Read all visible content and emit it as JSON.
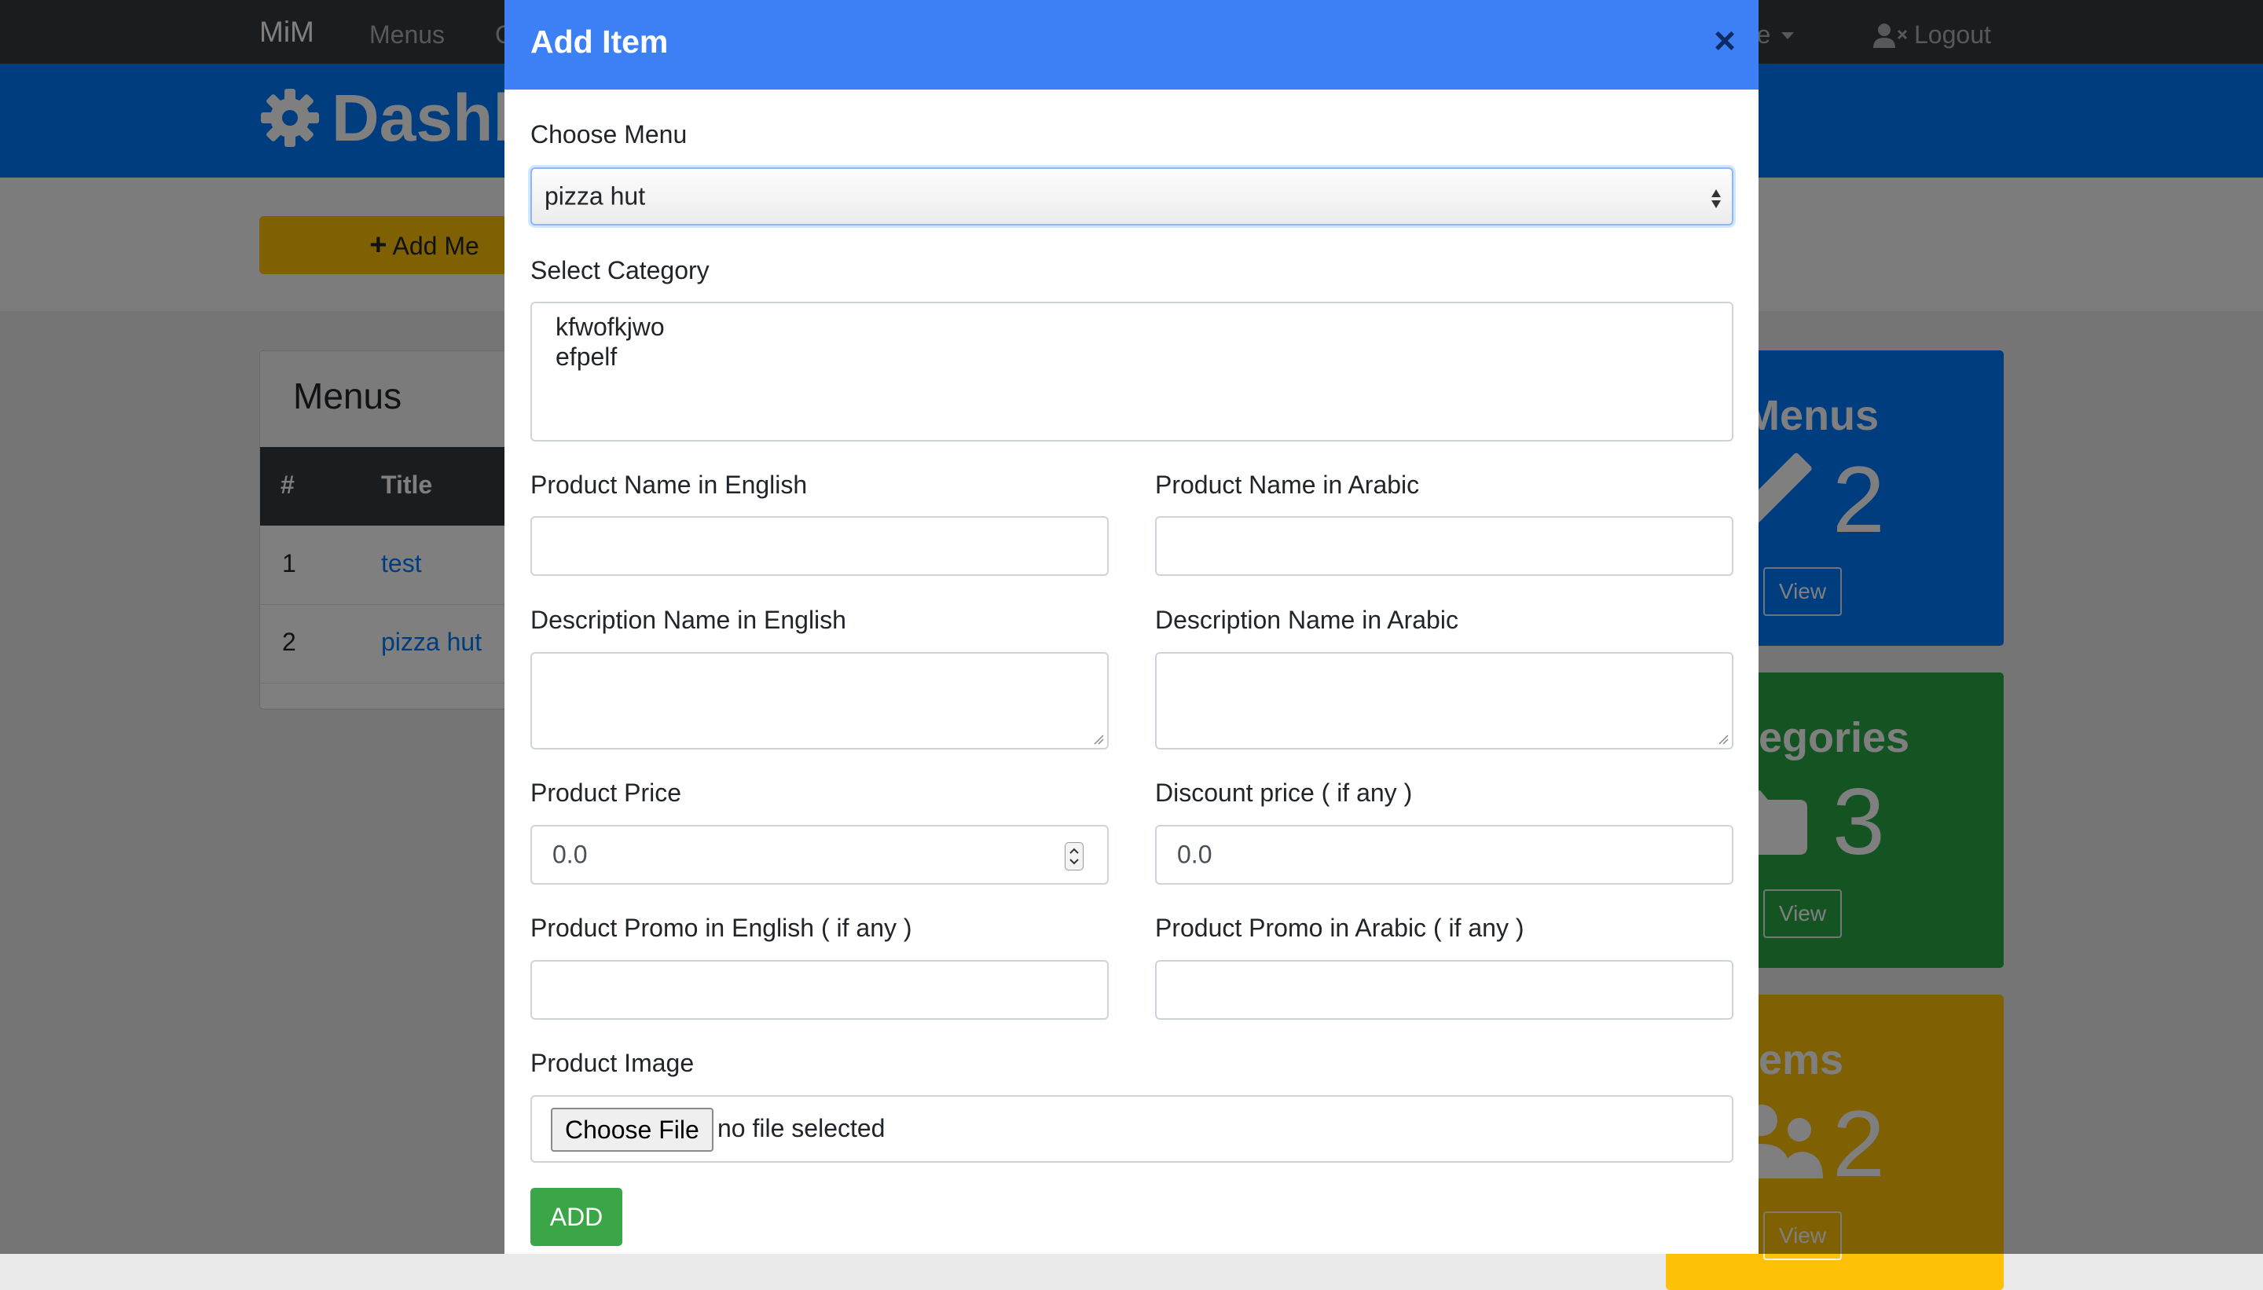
{
  "navbar": {
    "brand": "MiM",
    "menus_link": "Menus",
    "categories_link_partial": "C",
    "manage_link_partial": "age",
    "logout_label": "Logout"
  },
  "header": {
    "title_partial": "Dashb"
  },
  "actions": {
    "add_menu_label_partial": "Add Me"
  },
  "menus_card": {
    "title": "Menus",
    "columns": [
      "#",
      "Title"
    ],
    "rows": [
      {
        "num": "1",
        "title": "test"
      },
      {
        "num": "2",
        "title": "pizza hut"
      }
    ]
  },
  "stats": [
    {
      "title_partial": "Menus",
      "count": "2",
      "view_label": "View",
      "color": "#007bff",
      "icon": "pencil-icon"
    },
    {
      "title_partial": "tegories",
      "count": "3",
      "view_label": "View",
      "color": "#28a745",
      "icon": "folder-icon"
    },
    {
      "title_partial": "tems",
      "count": "2",
      "view_label": "View",
      "color": "#ffc107",
      "icon": "users-icon"
    }
  ],
  "modal": {
    "title": "Add Item",
    "close_symbol": "×",
    "choose_menu": {
      "label": "Choose Menu",
      "selected": "pizza hut"
    },
    "select_category": {
      "label": "Select Category",
      "options": [
        "kfwofkjwo",
        "efpelf"
      ]
    },
    "product_name_en": {
      "label": "Product Name in English",
      "value": ""
    },
    "product_name_ar": {
      "label": "Product Name in Arabic",
      "value": ""
    },
    "description_en": {
      "label": "Description Name in English",
      "value": ""
    },
    "description_ar": {
      "label": "Description Name in Arabic",
      "value": ""
    },
    "product_price": {
      "label": "Product Price",
      "value": "0.0"
    },
    "discount_price": {
      "label": "Discount price ( if any )",
      "value": "0.0"
    },
    "promo_en": {
      "label": "Product Promo in English ( if any )",
      "value": ""
    },
    "promo_ar": {
      "label": "Product Promo in Arabic ( if any )",
      "value": ""
    },
    "product_image": {
      "label": "Product Image",
      "button_label": "Choose File",
      "status": "no file selected"
    },
    "submit_label": "ADD"
  },
  "colors": {
    "navbar": "#343a40",
    "primary": "#007bff",
    "modal_header": "#3d7ff5",
    "success": "#28a745",
    "warning": "#ffc107"
  }
}
